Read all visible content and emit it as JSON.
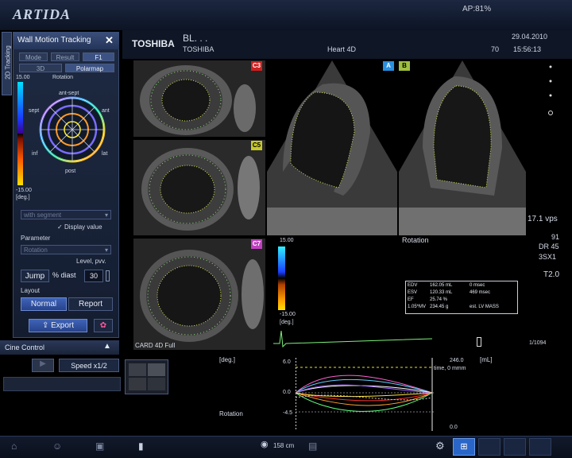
{
  "app": {
    "brand": "ARTIDA",
    "ap": "AP:81%"
  },
  "header": {
    "left_logo": "TOSHIBA",
    "left_name": "BL. . .",
    "sub": "TOSHIBA",
    "center": "Heart 4D",
    "date": "29.04.2010",
    "num": "70",
    "time": "15:56:13"
  },
  "side_tab": "2D Tracking",
  "panel": {
    "title": "Wall Motion Tracking",
    "close": "✕",
    "tabs": [
      "Mode",
      "Result",
      "F1"
    ],
    "tabs2": [
      "3D",
      "Polarmap"
    ],
    "scale_top": "15.00",
    "scale_unit_top": "Rotation",
    "scale_bottom": "-15.00",
    "scale_unit": "[deg.]",
    "ring": {
      "top": "ant-sept",
      "right": "ant",
      "left": "sept",
      "bottom": "post",
      "lower_left": "inf",
      "lower_right": "lat"
    },
    "segment_dropdown": "with segment",
    "display_value": "Display value",
    "parameter_label": "Parameter",
    "parameter_dropdown": "Rotation",
    "level_label": "Level, pvv.",
    "jump": "Jump",
    "pct_diast": "% diast",
    "pct_value": "30",
    "layout_label": "Layout",
    "normal": "Normal",
    "report": "Report",
    "export": "Export"
  },
  "cine": {
    "label": "Cine Control",
    "speed_label": "Speed",
    "speed_value": "x1/2"
  },
  "views": {
    "c3": "C3",
    "c5": "C5",
    "c7": "C7",
    "a": "A",
    "b": "B",
    "card": "CARD 4D Full"
  },
  "right_info": {
    "vps": "17.1 vps",
    "l1": "91",
    "l2": "DR 45",
    "l3": "3SX1",
    "l4": "T2.0"
  },
  "colorbar2": {
    "top": "15.00",
    "bottom": "-15.00",
    "unit": "[deg.]",
    "caption": "Rotation"
  },
  "table": {
    "rows": [
      [
        "EDV",
        "162.05 mL",
        "0 msec"
      ],
      [
        "ESV",
        "120.33 mL",
        "469 msec"
      ],
      [
        "EF",
        "25.74 %",
        ""
      ],
      [
        "1.05*MV",
        "234.45 g",
        "est. LV MASS"
      ]
    ]
  },
  "graph": {
    "yunit": "[deg.]",
    "rightunit": "[mL]",
    "ymax": "6.0",
    "ymid": "0.0",
    "ymin": "-4.5",
    "caption": "Rotation",
    "r_top": "246.0",
    "r_label": "time, 0 mmm",
    "r_bottom": "0.0",
    "ecg_marker": "1/1094"
  },
  "bottom": {
    "count": "158",
    "unit": "cm"
  }
}
